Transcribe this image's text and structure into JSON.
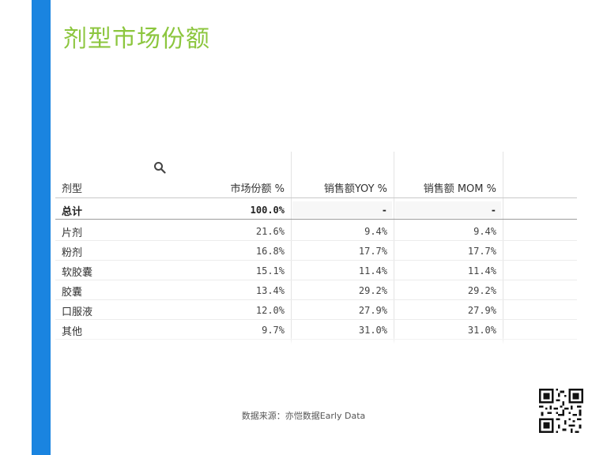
{
  "page": {
    "title": "剂型市场份额",
    "source": "数据来源：亦恺数据Early Data"
  },
  "table": {
    "headers": {
      "category": "剂型",
      "share": "市场份额 %",
      "yoy": "销售额YOY %",
      "mom": "销售额 MOM %"
    },
    "total": {
      "label": "总计",
      "share": "100.0%",
      "yoy": "-",
      "mom": "-"
    },
    "rows": [
      {
        "label": "片剂",
        "share": "21.6%",
        "yoy": "9.4%",
        "mom": "9.4%"
      },
      {
        "label": "粉剂",
        "share": "16.8%",
        "yoy": "17.7%",
        "mom": "17.7%"
      },
      {
        "label": "软胶囊",
        "share": "15.1%",
        "yoy": "11.4%",
        "mom": "11.4%"
      },
      {
        "label": "胶囊",
        "share": "13.4%",
        "yoy": "29.2%",
        "mom": "29.2%"
      },
      {
        "label": "口服液",
        "share": "12.0%",
        "yoy": "27.9%",
        "mom": "27.9%"
      },
      {
        "label": "其他",
        "share": "9.7%",
        "yoy": "31.0%",
        "mom": "31.0%"
      }
    ]
  },
  "colors": {
    "accent_bar": "#1a84e0",
    "title": "#8cc63e"
  },
  "icons": {
    "search": "search-icon",
    "qr": "qr-code-icon"
  }
}
